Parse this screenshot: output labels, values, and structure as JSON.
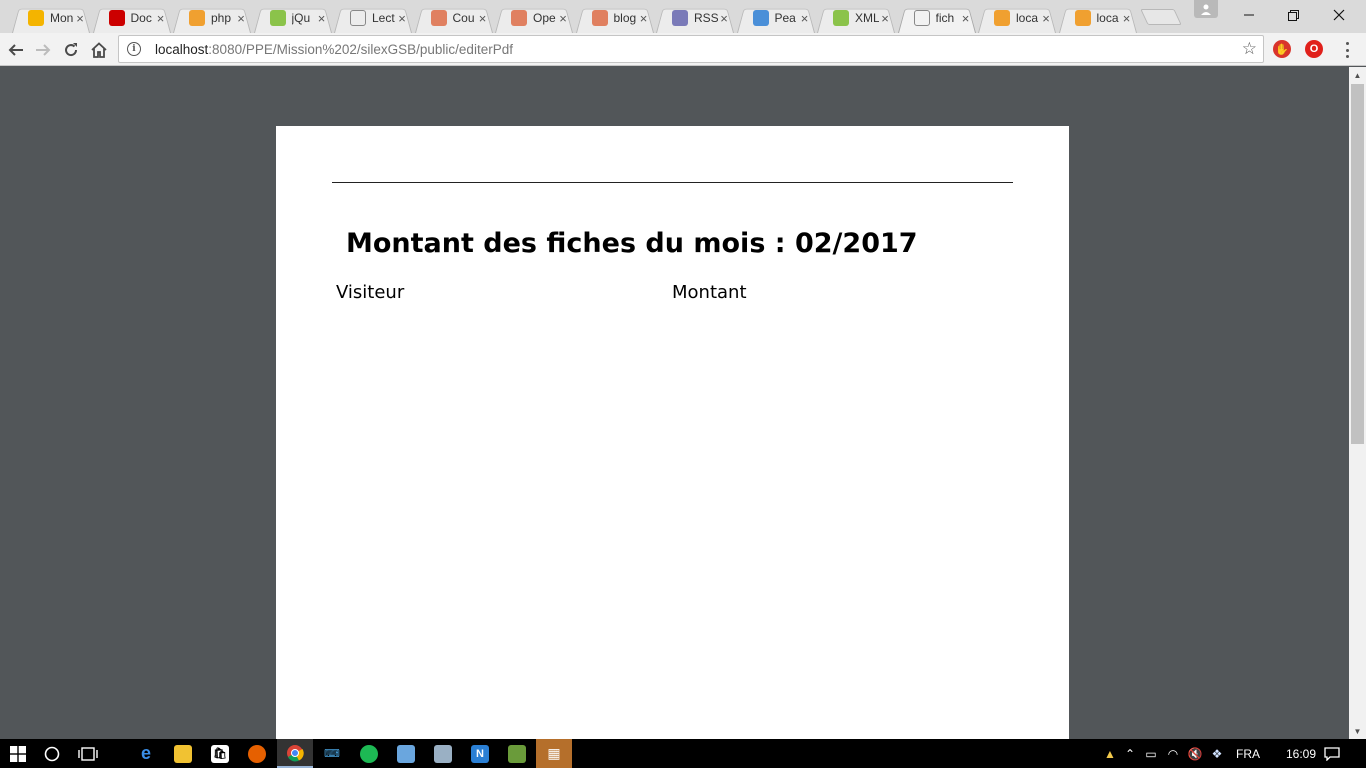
{
  "browser": {
    "tabs": [
      {
        "title": "Mon",
        "favicon": "google-drive-icon",
        "color": "#f4b400"
      },
      {
        "title": "Doc",
        "favicon": "free-icon",
        "color": "#cc0000"
      },
      {
        "title": "php",
        "favicon": "phpmyadmin-icon",
        "color": "#f0a030"
      },
      {
        "title": "jQu",
        "favicon": "w3schools-icon",
        "color": "#8bc34a"
      },
      {
        "title": "Lect",
        "favicon": "page-icon",
        "color": "#888888"
      },
      {
        "title": "Cou",
        "favicon": "brain-icon",
        "color": "#e08060"
      },
      {
        "title": "Ope",
        "favicon": "brain-icon",
        "color": "#e08060"
      },
      {
        "title": "blog",
        "favicon": "brain-icon",
        "color": "#e08060"
      },
      {
        "title": "RSS",
        "favicon": "circle-icon",
        "color": "#7a7ab8"
      },
      {
        "title": "Pea",
        "favicon": "pear-icon",
        "color": "#4a8fd8"
      },
      {
        "title": "XML",
        "favicon": "w3schools-icon",
        "color": "#8bc34a"
      },
      {
        "title": "fich",
        "favicon": "page-icon",
        "color": "#888888",
        "active": true
      },
      {
        "title": "loca",
        "favicon": "phpmyadmin-icon",
        "color": "#f0a030"
      },
      {
        "title": "loca",
        "favicon": "phpmyadmin-icon",
        "color": "#f0a030"
      }
    ],
    "url_host": "localhost",
    "url_rest": ":8080/PPE/Mission%202/silexGSB/public/editerPdf"
  },
  "document": {
    "title": "Montant des fiches du mois : 02/2017",
    "col_visitor": "Visiteur",
    "col_amount": "Montant"
  },
  "taskbar": {
    "language": "FRA",
    "time": "16:09"
  }
}
